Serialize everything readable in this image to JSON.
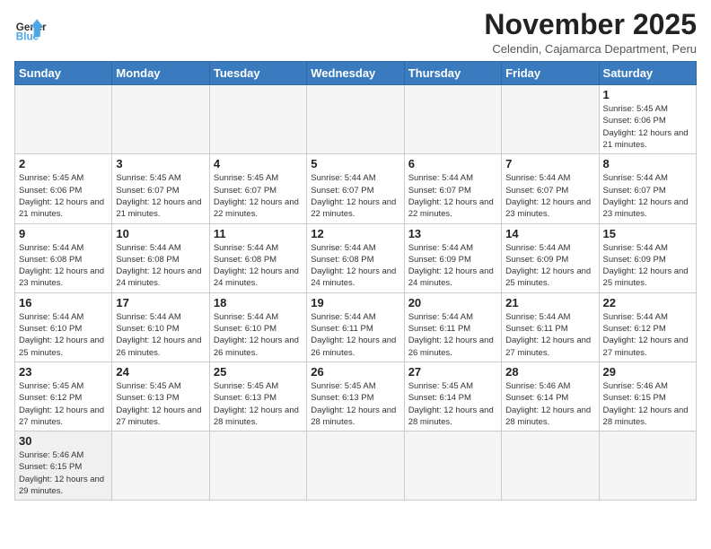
{
  "logo": {
    "general": "General",
    "blue": "Blue"
  },
  "title": "November 2025",
  "subtitle": "Celendin, Cajamarca Department, Peru",
  "days_of_week": [
    "Sunday",
    "Monday",
    "Tuesday",
    "Wednesday",
    "Thursday",
    "Friday",
    "Saturday"
  ],
  "weeks": [
    [
      null,
      null,
      null,
      null,
      null,
      null,
      {
        "day": 1,
        "sunrise": "5:45 AM",
        "sunset": "6:06 PM",
        "daylight": "12 hours and 21 minutes."
      }
    ],
    [
      {
        "day": 2,
        "sunrise": "5:45 AM",
        "sunset": "6:06 PM",
        "daylight": "12 hours and 21 minutes."
      },
      {
        "day": 3,
        "sunrise": "5:45 AM",
        "sunset": "6:07 PM",
        "daylight": "12 hours and 21 minutes."
      },
      {
        "day": 4,
        "sunrise": "5:45 AM",
        "sunset": "6:07 PM",
        "daylight": "12 hours and 22 minutes."
      },
      {
        "day": 5,
        "sunrise": "5:44 AM",
        "sunset": "6:07 PM",
        "daylight": "12 hours and 22 minutes."
      },
      {
        "day": 6,
        "sunrise": "5:44 AM",
        "sunset": "6:07 PM",
        "daylight": "12 hours and 22 minutes."
      },
      {
        "day": 7,
        "sunrise": "5:44 AM",
        "sunset": "6:07 PM",
        "daylight": "12 hours and 23 minutes."
      },
      {
        "day": 8,
        "sunrise": "5:44 AM",
        "sunset": "6:07 PM",
        "daylight": "12 hours and 23 minutes."
      }
    ],
    [
      {
        "day": 9,
        "sunrise": "5:44 AM",
        "sunset": "6:08 PM",
        "daylight": "12 hours and 23 minutes."
      },
      {
        "day": 10,
        "sunrise": "5:44 AM",
        "sunset": "6:08 PM",
        "daylight": "12 hours and 24 minutes."
      },
      {
        "day": 11,
        "sunrise": "5:44 AM",
        "sunset": "6:08 PM",
        "daylight": "12 hours and 24 minutes."
      },
      {
        "day": 12,
        "sunrise": "5:44 AM",
        "sunset": "6:08 PM",
        "daylight": "12 hours and 24 minutes."
      },
      {
        "day": 13,
        "sunrise": "5:44 AM",
        "sunset": "6:09 PM",
        "daylight": "12 hours and 24 minutes."
      },
      {
        "day": 14,
        "sunrise": "5:44 AM",
        "sunset": "6:09 PM",
        "daylight": "12 hours and 25 minutes."
      },
      {
        "day": 15,
        "sunrise": "5:44 AM",
        "sunset": "6:09 PM",
        "daylight": "12 hours and 25 minutes."
      }
    ],
    [
      {
        "day": 16,
        "sunrise": "5:44 AM",
        "sunset": "6:10 PM",
        "daylight": "12 hours and 25 minutes."
      },
      {
        "day": 17,
        "sunrise": "5:44 AM",
        "sunset": "6:10 PM",
        "daylight": "12 hours and 26 minutes."
      },
      {
        "day": 18,
        "sunrise": "5:44 AM",
        "sunset": "6:10 PM",
        "daylight": "12 hours and 26 minutes."
      },
      {
        "day": 19,
        "sunrise": "5:44 AM",
        "sunset": "6:11 PM",
        "daylight": "12 hours and 26 minutes."
      },
      {
        "day": 20,
        "sunrise": "5:44 AM",
        "sunset": "6:11 PM",
        "daylight": "12 hours and 26 minutes."
      },
      {
        "day": 21,
        "sunrise": "5:44 AM",
        "sunset": "6:11 PM",
        "daylight": "12 hours and 27 minutes."
      },
      {
        "day": 22,
        "sunrise": "5:44 AM",
        "sunset": "6:12 PM",
        "daylight": "12 hours and 27 minutes."
      }
    ],
    [
      {
        "day": 23,
        "sunrise": "5:45 AM",
        "sunset": "6:12 PM",
        "daylight": "12 hours and 27 minutes."
      },
      {
        "day": 24,
        "sunrise": "5:45 AM",
        "sunset": "6:13 PM",
        "daylight": "12 hours and 27 minutes."
      },
      {
        "day": 25,
        "sunrise": "5:45 AM",
        "sunset": "6:13 PM",
        "daylight": "12 hours and 28 minutes."
      },
      {
        "day": 26,
        "sunrise": "5:45 AM",
        "sunset": "6:13 PM",
        "daylight": "12 hours and 28 minutes."
      },
      {
        "day": 27,
        "sunrise": "5:45 AM",
        "sunset": "6:14 PM",
        "daylight": "12 hours and 28 minutes."
      },
      {
        "day": 28,
        "sunrise": "5:46 AM",
        "sunset": "6:14 PM",
        "daylight": "12 hours and 28 minutes."
      },
      {
        "day": 29,
        "sunrise": "5:46 AM",
        "sunset": "6:15 PM",
        "daylight": "12 hours and 28 minutes."
      }
    ],
    [
      {
        "day": 30,
        "sunrise": "5:46 AM",
        "sunset": "6:15 PM",
        "daylight": "12 hours and 29 minutes."
      },
      null,
      null,
      null,
      null,
      null,
      null
    ]
  ]
}
